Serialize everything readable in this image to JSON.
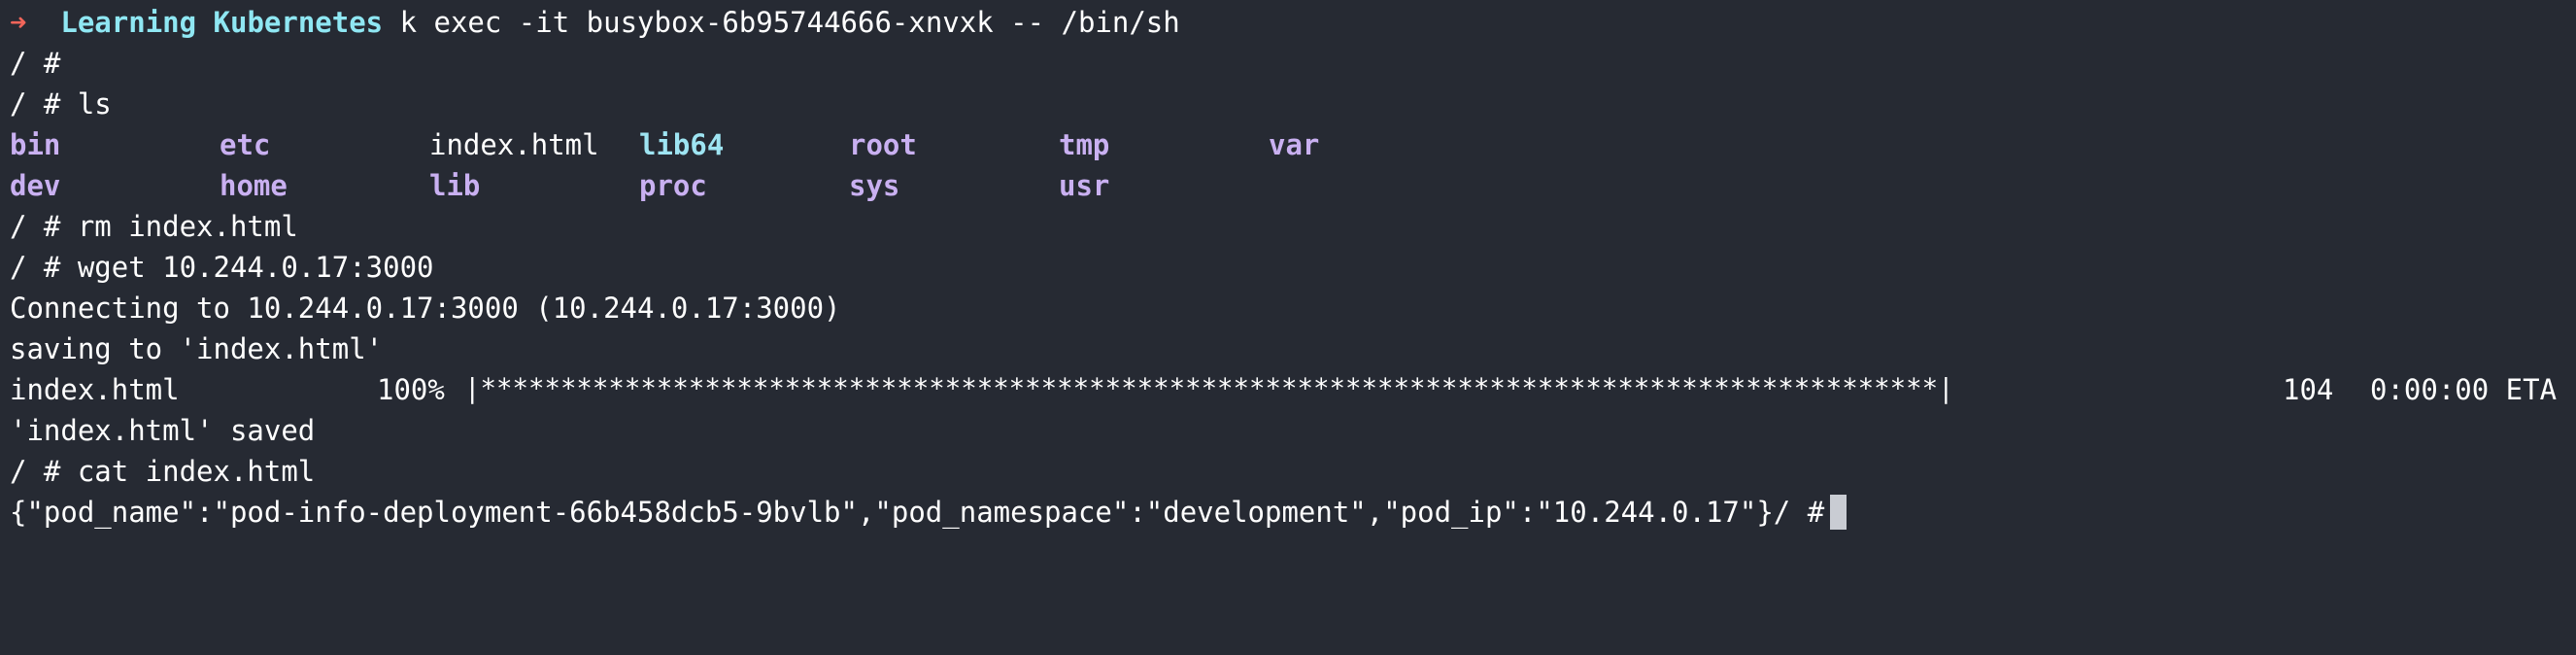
{
  "prompt": {
    "arrow": "➜",
    "directory": "Learning Kubernetes",
    "command": "k exec -it busybox-6b95744666-xnvxk -- /bin/sh"
  },
  "shell_prompt": "/ #",
  "lines": {
    "empty_prompt": "/ #",
    "ls_cmd": "/ # ls",
    "rm_cmd": "/ # rm index.html",
    "wget_cmd": "/ # wget 10.244.0.17:3000",
    "connecting": "Connecting to 10.244.0.17:3000 (10.244.0.17:3000)",
    "saving": "saving to 'index.html'",
    "saved": "'index.html' saved",
    "cat_cmd": "/ # cat index.html",
    "cat_output": "{\"pod_name\":\"pod-info-deployment-66b458dcb5-9bvlb\",\"pod_namespace\":\"development\",\"pod_ip\":\"10.244.0.17\"}/ #"
  },
  "ls_output": {
    "row1": [
      "bin",
      "etc",
      "index.html",
      "lib64",
      "root",
      "tmp",
      "var"
    ],
    "row2": [
      "dev",
      "home",
      "lib",
      "proc",
      "sys",
      "usr"
    ]
  },
  "progress": {
    "filename": "index.html",
    "percent": "100%",
    "bar": "|*******************************************************************************************|",
    "size": "104",
    "eta": "0:00:00 ETA"
  },
  "colors": {
    "background": "#262a33",
    "arrow": "#f2655a",
    "directory_prompt": "#8fe7f3",
    "ls_dir": "#c9b0f1",
    "ls_symlink": "#9ee4f2",
    "text": "#ffffff"
  }
}
